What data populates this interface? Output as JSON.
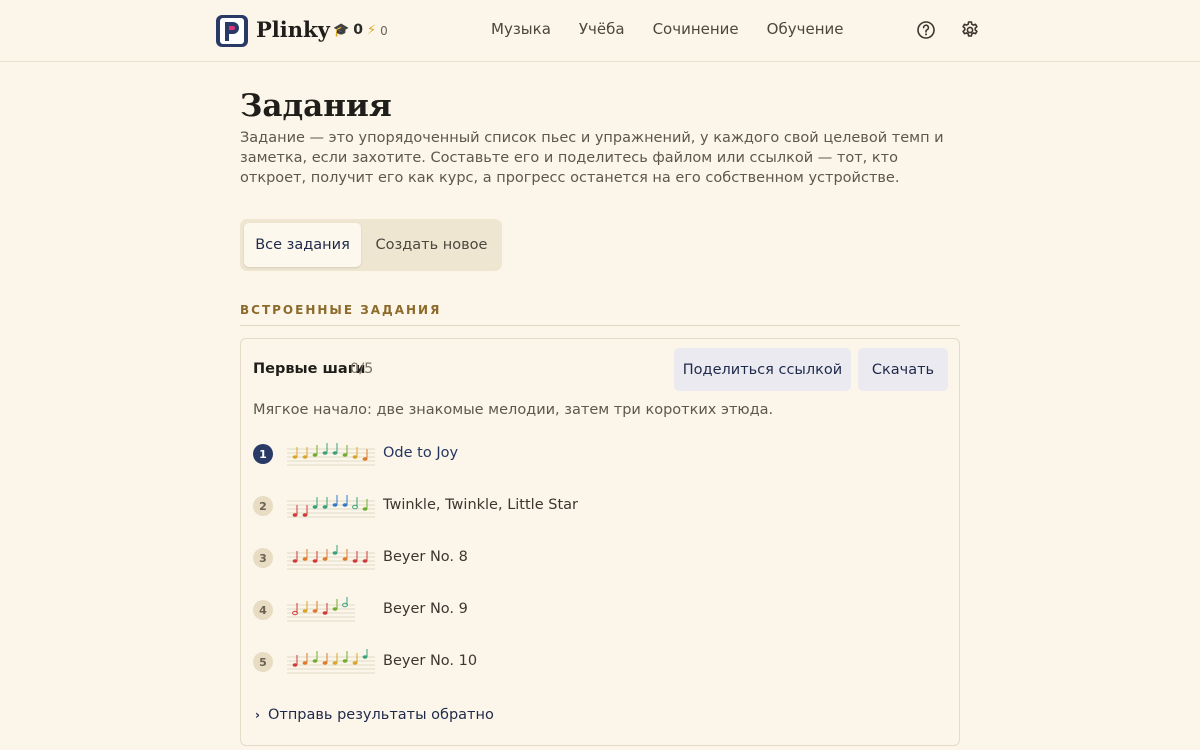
{
  "header": {
    "brand": "Plinky",
    "streak": {
      "icon": "graduation-cap-icon",
      "value": "0"
    },
    "energy": {
      "icon": "lightning-icon",
      "value": "0"
    },
    "nav": [
      "Музыка",
      "Учёба",
      "Сочинение",
      "Обучение"
    ],
    "icons": [
      "help-icon",
      "gear-icon"
    ]
  },
  "page": {
    "title": "Задания",
    "intro": "Задание — это упорядоченный список пьес и упражнений, у каждого свой целевой темп и заметка, если захотите. Составьте его и поделитесь файлом или ссылкой — тот, кто откроет, получит его как курс, а прогресс останется на его собственном устройстве.",
    "tabs": {
      "all": "Все задания",
      "new": "Создать новое"
    },
    "section_label": "ВСТРОЕННЫЕ ЗАДАНИЯ"
  },
  "assignment": {
    "title": "Первые шаги",
    "count": "0/5",
    "share_label": "Поделиться ссылкой",
    "download_label": "Скачать",
    "description": "Мягкое начало: две знакомые мелодии, затем три коротких этюда.",
    "items": [
      {
        "num": "1",
        "label": "Ode to Joy",
        "active": true
      },
      {
        "num": "2",
        "label": "Twinkle, Twinkle, Little Star",
        "active": false
      },
      {
        "num": "3",
        "label": "Beyer No. 8",
        "active": false
      },
      {
        "num": "4",
        "label": "Beyer No. 9",
        "active": false
      },
      {
        "num": "5",
        "label": "Beyer No. 10",
        "active": false
      }
    ],
    "expander_label": "Отправь результаты обратно"
  },
  "colors": {
    "background": "#fcf6ea",
    "accent": "#2a3a66",
    "section_label": "#8c6a2a",
    "button_bg": "#eaeaf0"
  }
}
